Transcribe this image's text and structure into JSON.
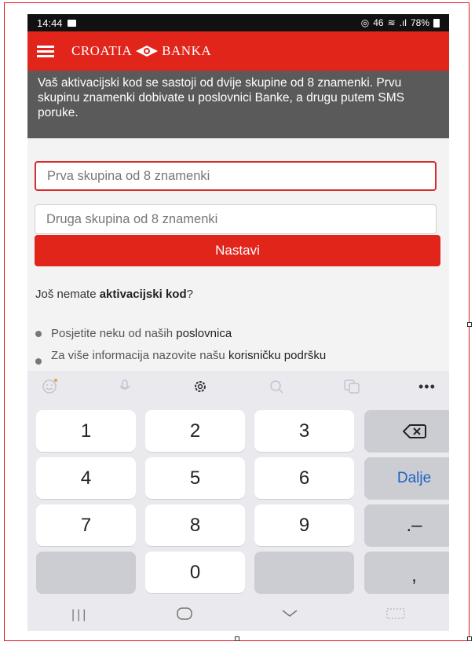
{
  "status_bar": {
    "time": "14:44",
    "network": "46",
    "battery": "78%"
  },
  "app_bar": {
    "logo_left": "CROATIA",
    "logo_right": "BANKA"
  },
  "info_text": "Vaš aktivacijski kod se sastoji od dvije skupine od 8 znamenki. Prvu skupinu znamenki dobivate u poslovnici Banke, a drugu putem SMS poruke.",
  "form": {
    "first_placeholder": "Prva skupina od 8 znamenki",
    "second_placeholder": "Druga skupina od 8 znamenki",
    "continue_label": "Nastavi"
  },
  "help": {
    "prefix": "Još nemate ",
    "bold": "aktivacijski kod",
    "suffix": "?",
    "item1_text": "Posjetite neku od naših ",
    "item1_link": "poslovnica",
    "item2_text": "Za više informacija nazovite našu ",
    "item2_link": "korisničku podršku"
  },
  "keyboard": {
    "keys": [
      "1",
      "2",
      "3",
      "4",
      "5",
      "6",
      "7",
      "8",
      "9",
      "0"
    ],
    "dalje": "Dalje",
    "dot_dash": ".–",
    "comma": ","
  },
  "colors": {
    "brand_red": "#e1251b",
    "info_bg": "#5a5a5a",
    "dalje_blue": "#1b63c2"
  },
  "icons": [
    "menu-icon",
    "logo-icon",
    "emoji-icon",
    "mic-icon",
    "settings-icon",
    "search-icon",
    "translate-icon",
    "more-icon",
    "backspace-icon",
    "recents-icon",
    "home-icon",
    "back-icon",
    "keyboard-icon"
  ]
}
